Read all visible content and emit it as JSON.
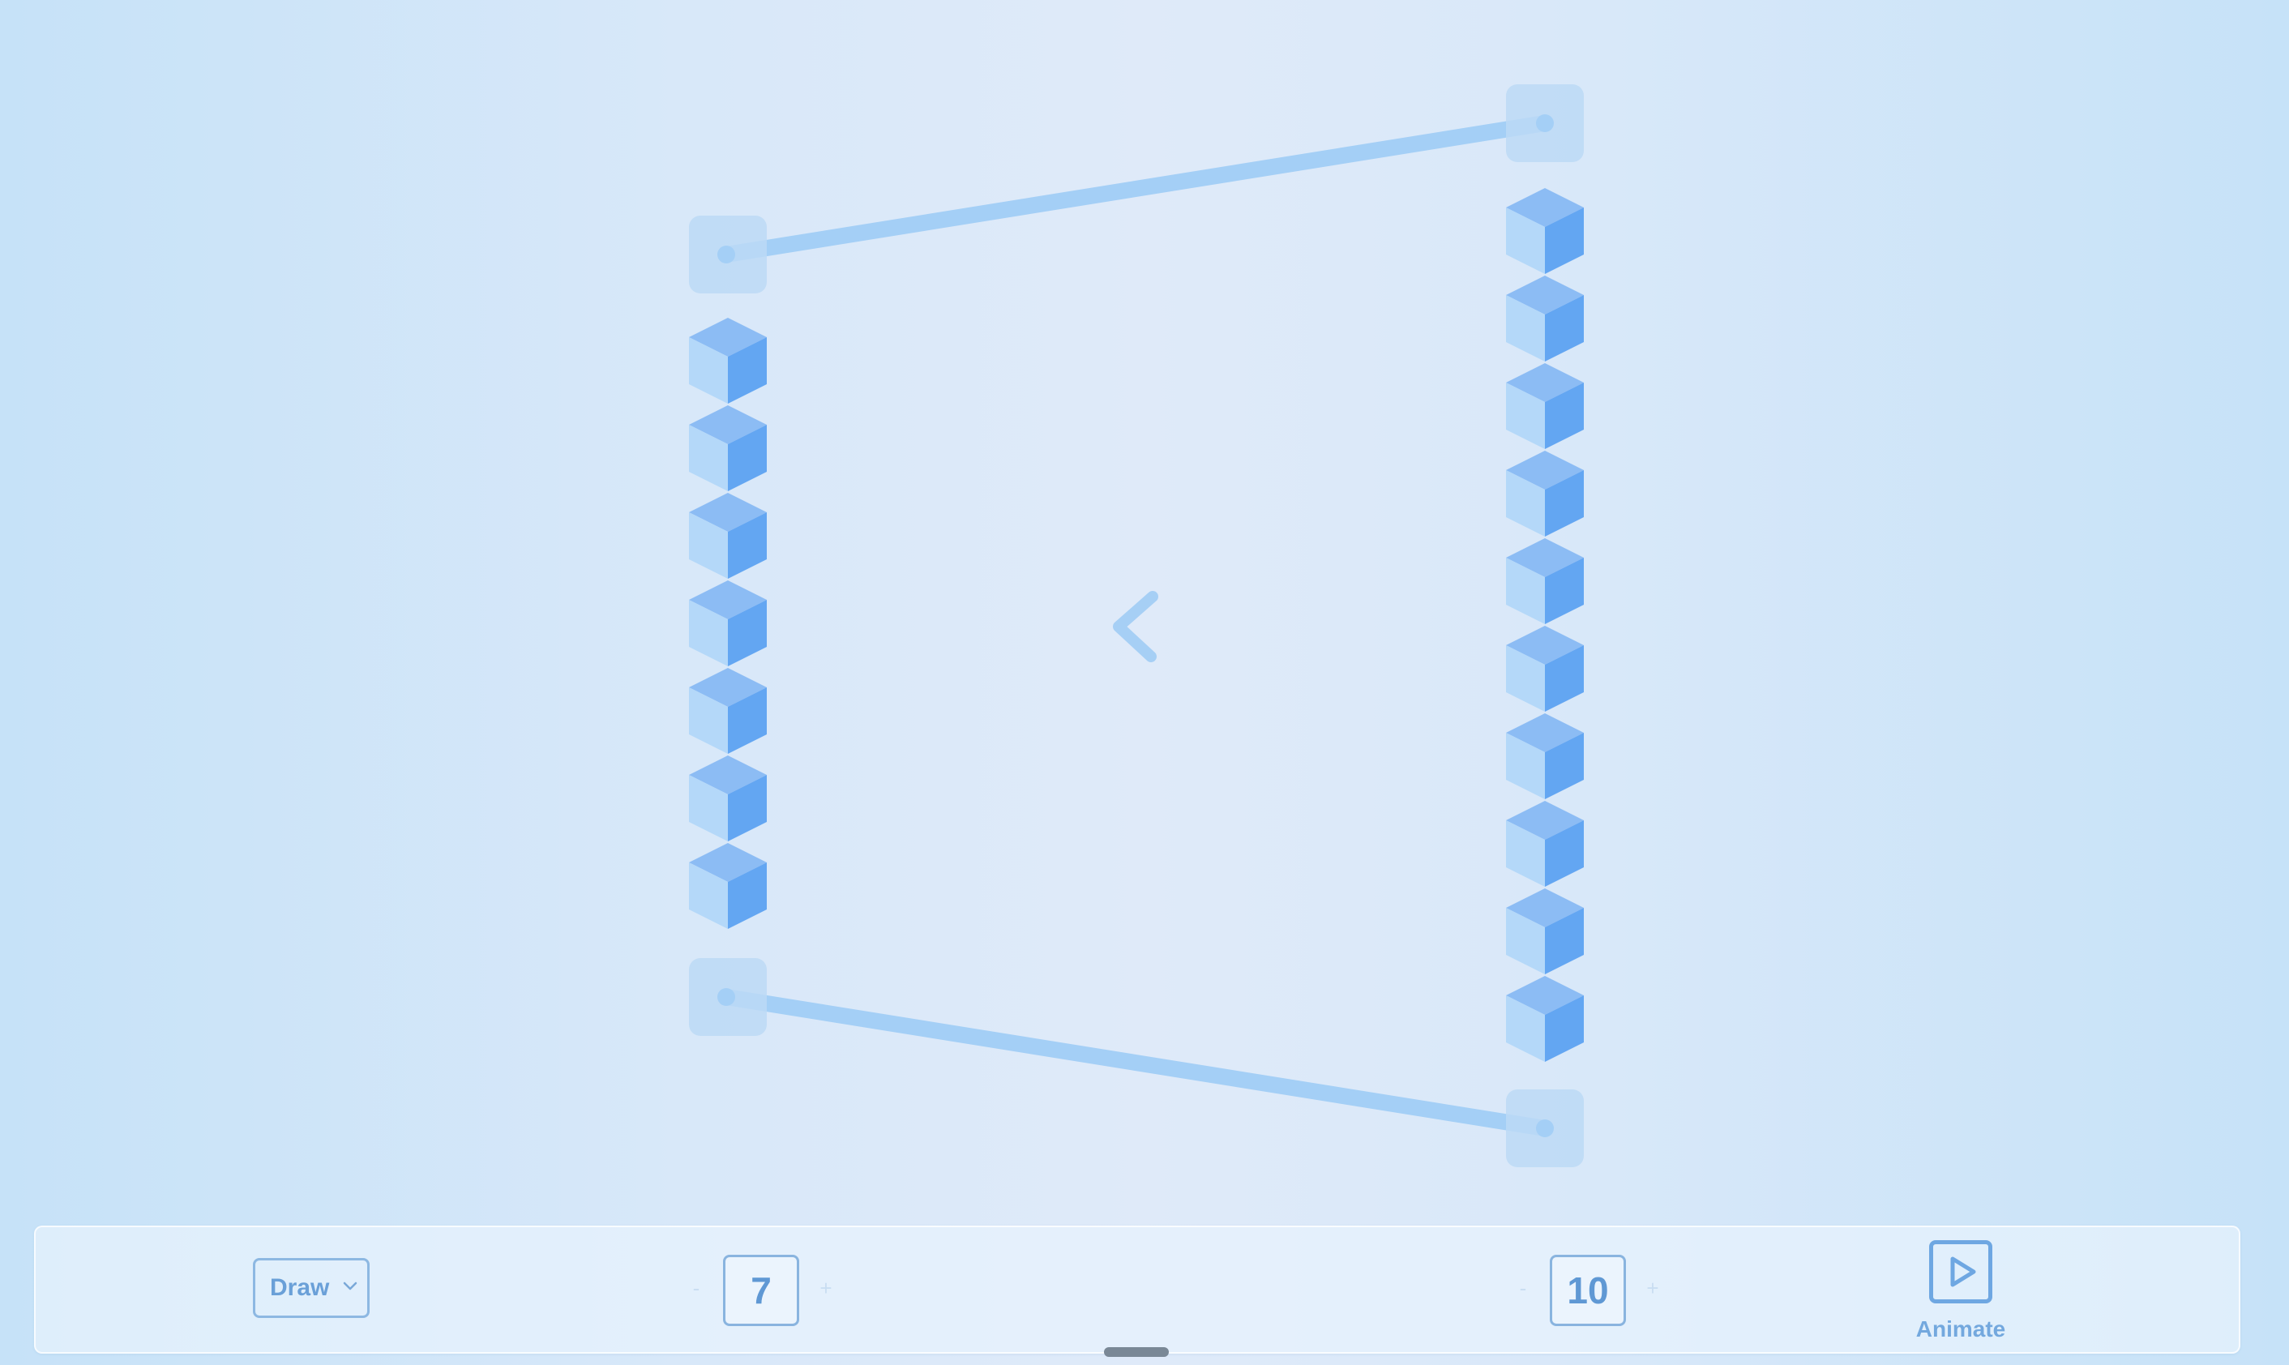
{
  "toolbar": {
    "mode_select": {
      "value": "Draw"
    },
    "left_stack": {
      "value": "7",
      "decrement": "-",
      "increment": "+"
    },
    "right_stack": {
      "value": "10",
      "decrement": "-",
      "increment": "+"
    },
    "animate": {
      "label": "Animate",
      "icon": "play-icon"
    }
  },
  "comparison": {
    "symbol": "less-than",
    "icon": "less-than-icon"
  },
  "colors": {
    "cube_top": "#8cbcf4",
    "cube_left": "#b4d8f9",
    "cube_right": "#63a6f2",
    "line": "#a4cff6",
    "accent": "#6ea7e2"
  }
}
